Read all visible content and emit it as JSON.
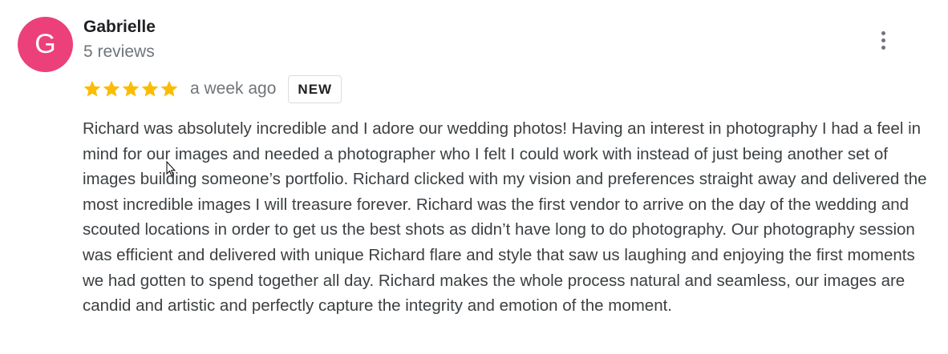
{
  "review": {
    "avatar_letter": "G",
    "avatar_color": "#ec407a",
    "author_name": "Gabrielle",
    "review_count": "5 reviews",
    "rating": 5,
    "rating_max": 5,
    "star_color": "#fbbc04",
    "date": "a week ago",
    "badge": "NEW",
    "text": "Richard was absolutely incredible and I adore our wedding photos! Having an interest in photography I had a feel in mind for our images and needed a photographer who I felt I could work with instead of just being another set of images building someone’s portfolio. Richard clicked with my vision and preferences straight away and delivered the most incredible images I will treasure forever. Richard was the first vendor to arrive on the day of the wedding and scouted locations in order to get us the best shots as didn’t have long to do photography. Our photography session was efficient and delivered with unique Richard flare and style that saw us laughing and enjoying the first moments we had gotten to spend together all day. Richard makes the whole process natural and seamless, our images are candid and artistic and perfectly capture the integrity and emotion of the moment.",
    "more_icon": "more-vert-icon"
  }
}
